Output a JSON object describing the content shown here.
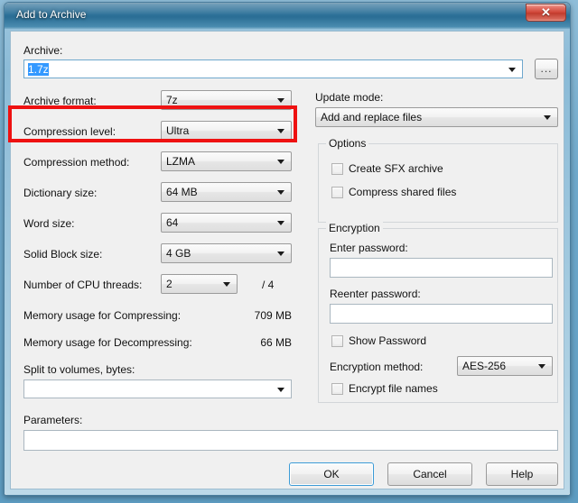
{
  "window": {
    "title": "Add to Archive",
    "close_label": "✕"
  },
  "archive": {
    "label": "Archive:",
    "value": "1.7z",
    "browse_label": "...",
    "placeholder": ""
  },
  "left_panel": {
    "archive_format": {
      "label": "Archive format:",
      "value": "7z"
    },
    "compression_level": {
      "label": "Compression level:",
      "value": "Ultra"
    },
    "compression_method": {
      "label": "Compression method:",
      "value": "LZMA"
    },
    "dictionary_size": {
      "label": "Dictionary size:",
      "value": "64 MB"
    },
    "word_size": {
      "label": "Word size:",
      "value": "64"
    },
    "solid_block_size": {
      "label": "Solid Block size:",
      "value": "4 GB"
    },
    "cpu_threads": {
      "label": "Number of CPU threads:",
      "value": "2",
      "max_suffix": "/ 4"
    },
    "mem_compress": {
      "label": "Memory usage for Compressing:",
      "value": "709 MB"
    },
    "mem_decompress": {
      "label": "Memory usage for Decompressing:",
      "value": "66 MB"
    },
    "split_volumes": {
      "label": "Split to volumes, bytes:",
      "value": ""
    }
  },
  "right_panel": {
    "update_mode": {
      "label": "Update mode:",
      "value": "Add and replace files"
    },
    "options": {
      "title": "Options",
      "checkboxes": [
        {
          "label": "Create SFX archive",
          "checked": false
        },
        {
          "label": "Compress shared files",
          "checked": false
        }
      ]
    },
    "encryption": {
      "title": "Encryption",
      "enter_password": {
        "label": "Enter password:",
        "value": ""
      },
      "reenter_password": {
        "label": "Reenter password:",
        "value": ""
      },
      "show_password": {
        "label": "Show Password",
        "checked": false
      },
      "encryption_method": {
        "label": "Encryption method:",
        "value": "AES-256"
      },
      "encrypt_file_names": {
        "label": "Encrypt file names",
        "checked": false
      }
    }
  },
  "parameters": {
    "label": "Parameters:",
    "value": ""
  },
  "buttons": {
    "ok": "OK",
    "cancel": "Cancel",
    "help": "Help"
  },
  "annotation": {
    "highlight_color": "#ee1111",
    "highlight_target": "compression-level-row"
  }
}
